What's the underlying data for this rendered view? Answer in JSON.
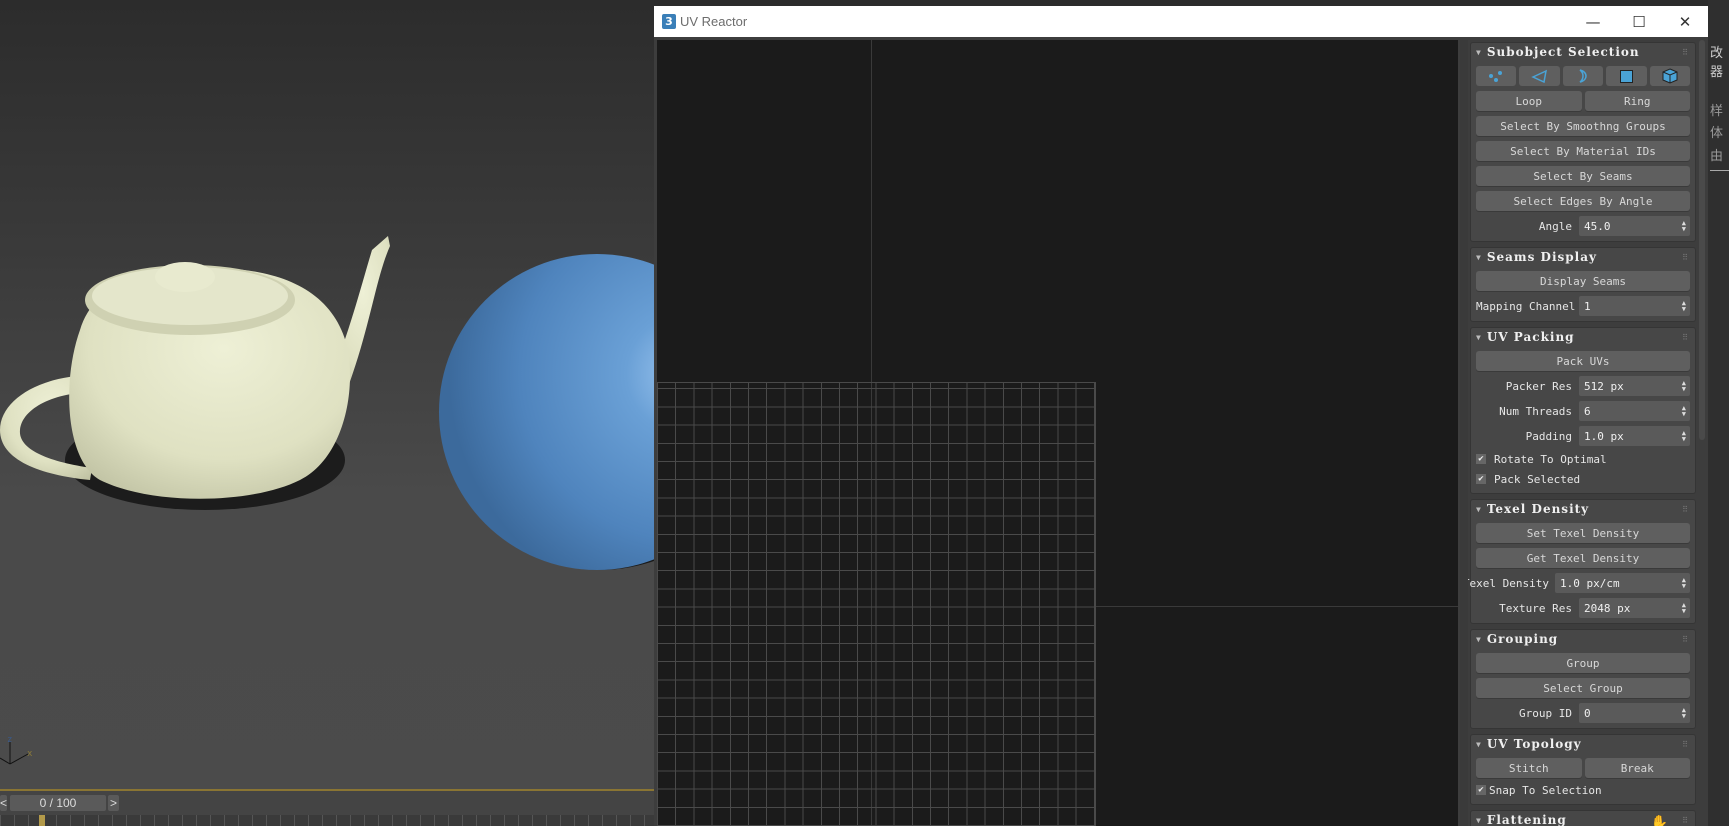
{
  "viewport": {
    "timeline": {
      "frame": "0 / 100",
      "prev": "<",
      "next": ">"
    },
    "axis": {
      "z": "z",
      "x": "x"
    }
  },
  "window": {
    "title": "UV Reactor",
    "minimize": "—",
    "maximize": "☐",
    "close": "✕"
  },
  "panel": {
    "subobject": {
      "title": "Subobject Selection",
      "icons": [
        "vertex-icon",
        "edge-icon",
        "border-icon",
        "face-icon",
        "element-icon"
      ],
      "loop": "Loop",
      "ring": "Ring",
      "smoothing": "Select By Smoothng Groups",
      "material": "Select By Material IDs",
      "seams": "Select By Seams",
      "edges_angle": "Select Edges By Angle",
      "angle_label": "Angle",
      "angle_value": "45.0"
    },
    "seams_display": {
      "title": "Seams Display",
      "display_seams": "Display Seams",
      "mapping_label": "Mapping Channel",
      "mapping_value": "1"
    },
    "uv_packing": {
      "title": "UV Packing",
      "pack": "Pack UVs",
      "packer_res_label": "Packer Res",
      "packer_res": "512 px",
      "threads_label": "Num Threads",
      "threads": "6",
      "padding_label": "Padding",
      "padding": "1.0 px",
      "rotate": "Rotate To Optimal",
      "rotate_checked": true,
      "pack_selected": "Pack Selected",
      "pack_selected_checked": true
    },
    "texel": {
      "title": "Texel Density",
      "set": "Set Texel Density",
      "get": "Get Texel Density",
      "density_label": "Texel Density",
      "density": "1.0 px/cm",
      "texres_label": "Texture Res",
      "texres": "2048 px"
    },
    "grouping": {
      "title": "Grouping",
      "group": "Group",
      "select_group": "Select Group",
      "group_id_label": "Group ID",
      "group_id": "0"
    },
    "topology": {
      "title": "UV Topology",
      "stitch": "Stitch",
      "break": "Break",
      "snap": "Snap To Selection",
      "snap_checked": true
    },
    "flattening": {
      "title": "Flattening"
    }
  },
  "right_strip": [
    "改器",
    "样",
    "体",
    "由"
  ],
  "colors": {
    "sphere": "#5b8fc7",
    "teapot": "#e2e4c6",
    "accent_icon": "#4aa3d6",
    "timeline_line": "#8a7533"
  }
}
